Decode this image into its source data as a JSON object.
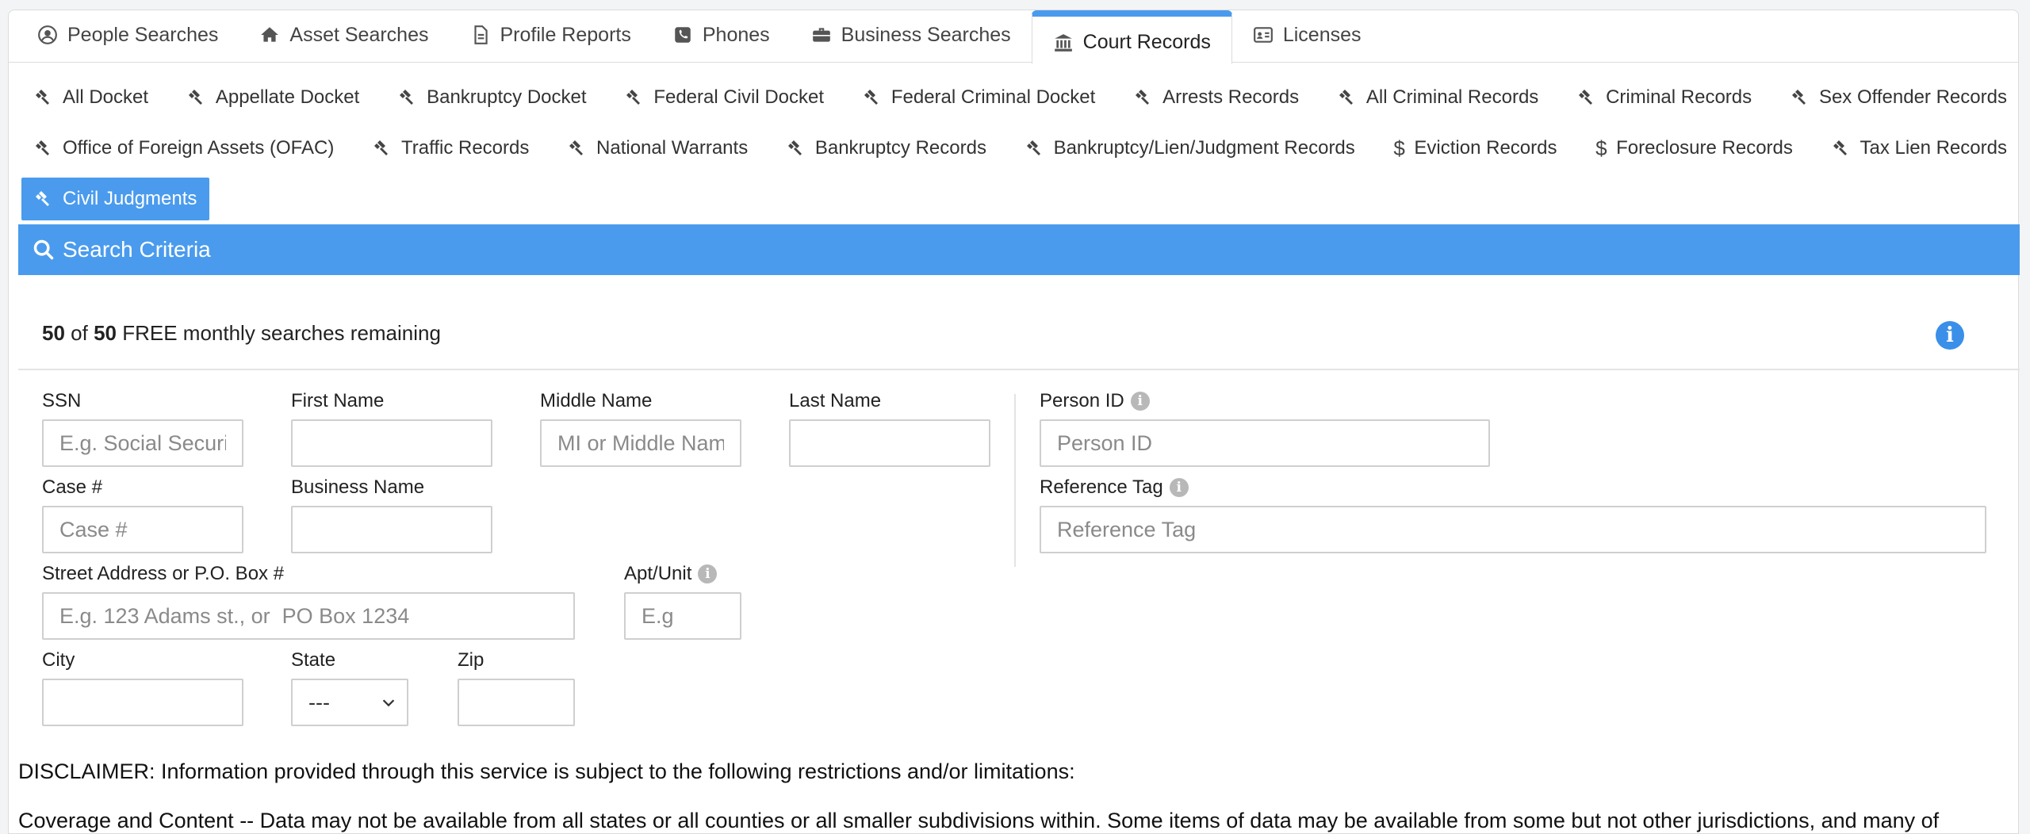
{
  "tabs": [
    {
      "label": "People Searches",
      "icon": "user-circle-icon"
    },
    {
      "label": "Asset Searches",
      "icon": "home-icon"
    },
    {
      "label": "Profile Reports",
      "icon": "document-icon"
    },
    {
      "label": "Phones",
      "icon": "phone-icon"
    },
    {
      "label": "Business Searches",
      "icon": "briefcase-icon"
    },
    {
      "label": "Court Records",
      "icon": "courthouse-icon",
      "active": true
    },
    {
      "label": "Licenses",
      "icon": "id-card-icon"
    }
  ],
  "subtabs_row1": [
    {
      "label": "All Docket",
      "icon": "gavel-icon"
    },
    {
      "label": "Appellate Docket",
      "icon": "gavel-icon"
    },
    {
      "label": "Bankruptcy Docket",
      "icon": "gavel-icon"
    },
    {
      "label": "Federal Civil Docket",
      "icon": "gavel-icon"
    },
    {
      "label": "Federal Criminal Docket",
      "icon": "gavel-icon"
    },
    {
      "label": "Arrests Records",
      "icon": "gavel-icon"
    },
    {
      "label": "All Criminal Records",
      "icon": "gavel-icon"
    },
    {
      "label": "Criminal Records",
      "icon": "gavel-icon"
    },
    {
      "label": "Sex Offender Records",
      "icon": "gavel-icon"
    }
  ],
  "subtabs_row2": [
    {
      "label": "Office of Foreign Assets (OFAC)",
      "icon": "gavel-icon"
    },
    {
      "label": "Traffic Records",
      "icon": "gavel-icon"
    },
    {
      "label": "National Warrants",
      "icon": "gavel-icon"
    },
    {
      "label": "Bankruptcy Records",
      "icon": "gavel-icon"
    },
    {
      "label": "Bankruptcy/Lien/Judgment Records",
      "icon": "gavel-icon"
    },
    {
      "label": "Eviction Records",
      "icon": "dollar-icon"
    },
    {
      "label": "Foreclosure Records",
      "icon": "dollar-icon"
    },
    {
      "label": "Tax Lien Records",
      "icon": "gavel-icon"
    }
  ],
  "subtabs_row3": [
    {
      "label": "Civil Judgments",
      "icon": "gavel-icon",
      "active": true
    }
  ],
  "search_header": {
    "title": "Search Criteria"
  },
  "quota": {
    "used": "50",
    "of": "of",
    "total": "50",
    "suffix": "FREE monthly searches remaining"
  },
  "form": {
    "ssn": {
      "label": "SSN",
      "placeholder": "E.g. Social Security Number"
    },
    "first_name": {
      "label": "First Name",
      "placeholder": ""
    },
    "middle_name": {
      "label": "Middle Name",
      "placeholder": "MI or Middle Name"
    },
    "last_name": {
      "label": "Last Name",
      "placeholder": ""
    },
    "person_id": {
      "label": "Person ID",
      "placeholder": "Person ID"
    },
    "case_no": {
      "label": "Case #",
      "placeholder": "Case #"
    },
    "business_name": {
      "label": "Business Name",
      "placeholder": ""
    },
    "reference_tag": {
      "label": "Reference Tag",
      "placeholder": "Reference Tag"
    },
    "street": {
      "label": "Street Address or P.O. Box #",
      "placeholder": "E.g. 123 Adams st., or  PO Box 1234"
    },
    "apt": {
      "label": "Apt/Unit",
      "placeholder": "E.g"
    },
    "city": {
      "label": "City",
      "placeholder": ""
    },
    "state": {
      "label": "State",
      "value": "---"
    },
    "zip": {
      "label": "Zip",
      "placeholder": ""
    }
  },
  "disclaimer": "DISCLAIMER: Information provided through this service is subject to the following restrictions and/or limitations:",
  "coverage": "Coverage and Content -- Data may not be available from all states or all counties or all smaller subdivisions within. Some items of data may be available from some but not other jurisdictions, and many of",
  "colors": {
    "accent": "#4a9bed",
    "info": "#3a8fe8"
  }
}
